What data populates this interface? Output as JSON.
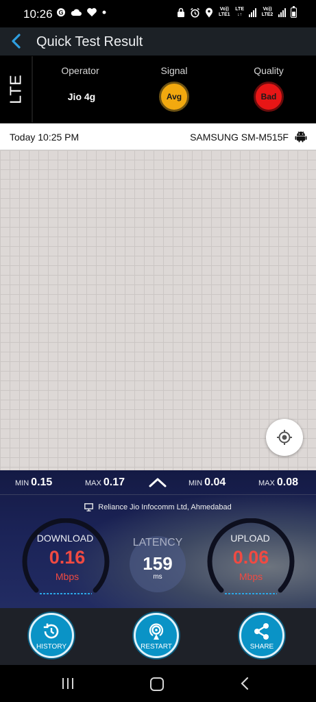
{
  "status_bar": {
    "time": "10:26",
    "left_icons": [
      "g-icon",
      "cloud-icon",
      "heart-icon",
      "dot-icon"
    ],
    "sim1_label": "Vo)) LTE1",
    "sim2_label": "Vo)) LTE2",
    "lte_label": "LTE"
  },
  "header": {
    "title": "Quick Test Result"
  },
  "info": {
    "technology": "LTE",
    "operator_heading": "Operator",
    "operator": "Jio 4g",
    "signal_heading": "Signal",
    "signal": "Avg",
    "signal_color": "#f2a90f",
    "quality_heading": "Quality",
    "quality": "Bad",
    "quality_color": "#e81616"
  },
  "test_meta": {
    "datetime": "Today 10:25 PM",
    "device": "SAMSUNG SM-M515F"
  },
  "results": {
    "download_min_label": "MIN",
    "download_min": "0.15",
    "download_max_label": "MAX",
    "download_max": "0.17",
    "upload_min_label": "MIN",
    "upload_min": "0.04",
    "upload_max_label": "MAX",
    "upload_max": "0.08",
    "isp": "Reliance Jio Infocomm Ltd, Ahmedabad",
    "download_label": "DOWNLOAD",
    "download_value": "0.16",
    "download_unit": "Mbps",
    "latency_label": "LATENCY",
    "latency_value": "159",
    "latency_unit": "ms",
    "upload_label": "UPLOAD",
    "upload_value": "0.06",
    "upload_unit": "Mbps",
    "value_color": "#f04a42"
  },
  "actions": {
    "history": "HISTORY",
    "restart": "RESTART",
    "share": "SHARE"
  }
}
